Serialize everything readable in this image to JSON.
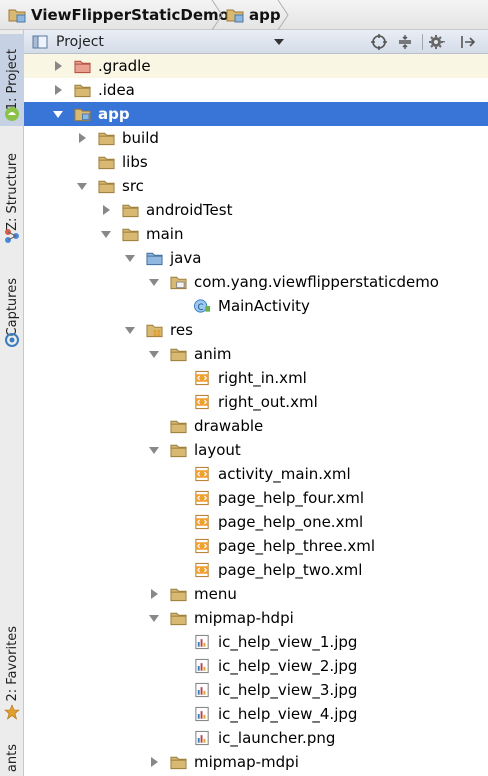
{
  "breadcrumb": {
    "project": "ViewFlipperStaticDemo",
    "module": "app"
  },
  "sidebar": {
    "tabs": [
      {
        "label": "1: Project",
        "icon": "android-icon"
      },
      {
        "label": "Z: Structure",
        "icon": "structure-icon"
      },
      {
        "label": "Captures",
        "icon": "camera-icon"
      },
      {
        "label": "2: Favorites",
        "icon": "star-icon"
      },
      {
        "label": "ants",
        "icon": "ant-icon"
      }
    ]
  },
  "toolbar": {
    "view_label": "Project",
    "icons": [
      "scroll-from-source-icon",
      "collapse-all-icon",
      "gear-icon",
      "hide-icon"
    ]
  },
  "colors": {
    "selection": "#3875d7",
    "hover": "#f9f7e4",
    "folder": "#d9b872",
    "java_folder": "#6ea2d8"
  },
  "tree": [
    {
      "label": ".gradle",
      "icon": "folder-excluded-icon",
      "arrow": "collapsed",
      "state": "hover"
    },
    {
      "label": ".idea",
      "icon": "folder-icon",
      "arrow": "collapsed"
    },
    {
      "label": "app",
      "icon": "module-folder-icon",
      "arrow": "expanded",
      "state": "selected"
    },
    {
      "label": "build",
      "icon": "folder-icon",
      "arrow": "collapsed"
    },
    {
      "label": "libs",
      "icon": "folder-icon",
      "arrow": "none"
    },
    {
      "label": "src",
      "icon": "folder-icon",
      "arrow": "expanded"
    },
    {
      "label": "androidTest",
      "icon": "folder-icon",
      "arrow": "collapsed"
    },
    {
      "label": "main",
      "icon": "folder-icon",
      "arrow": "expanded"
    },
    {
      "label": "java",
      "icon": "source-folder-icon",
      "arrow": "expanded"
    },
    {
      "label": "com.yang.viewflipperstaticdemo",
      "icon": "package-icon",
      "arrow": "expanded"
    },
    {
      "label": "MainActivity",
      "icon": "class-icon",
      "arrow": "none"
    },
    {
      "label": "res",
      "icon": "resource-folder-icon",
      "arrow": "expanded"
    },
    {
      "label": "anim",
      "icon": "folder-icon",
      "arrow": "expanded"
    },
    {
      "label": "right_in.xml",
      "icon": "xml-file-icon",
      "arrow": "none"
    },
    {
      "label": "right_out.xml",
      "icon": "xml-file-icon",
      "arrow": "none"
    },
    {
      "label": "drawable",
      "icon": "folder-icon",
      "arrow": "none"
    },
    {
      "label": "layout",
      "icon": "folder-icon",
      "arrow": "expanded"
    },
    {
      "label": "activity_main.xml",
      "icon": "xml-file-icon",
      "arrow": "none"
    },
    {
      "label": "page_help_four.xml",
      "icon": "xml-file-icon",
      "arrow": "none"
    },
    {
      "label": "page_help_one.xml",
      "icon": "xml-file-icon",
      "arrow": "none"
    },
    {
      "label": "page_help_three.xml",
      "icon": "xml-file-icon",
      "arrow": "none"
    },
    {
      "label": "page_help_two.xml",
      "icon": "xml-file-icon",
      "arrow": "none"
    },
    {
      "label": "menu",
      "icon": "folder-icon",
      "arrow": "collapsed"
    },
    {
      "label": "mipmap-hdpi",
      "icon": "folder-icon",
      "arrow": "expanded"
    },
    {
      "label": "ic_help_view_1.jpg",
      "icon": "image-file-icon",
      "arrow": "none"
    },
    {
      "label": "ic_help_view_2.jpg",
      "icon": "image-file-icon",
      "arrow": "none"
    },
    {
      "label": "ic_help_view_3.jpg",
      "icon": "image-file-icon",
      "arrow": "none"
    },
    {
      "label": "ic_help_view_4.jpg",
      "icon": "image-file-icon",
      "arrow": "none"
    },
    {
      "label": "ic_launcher.png",
      "icon": "image-file-icon",
      "arrow": "none"
    },
    {
      "label": "mipmap-mdpi",
      "icon": "folder-icon",
      "arrow": "collapsed"
    }
  ]
}
